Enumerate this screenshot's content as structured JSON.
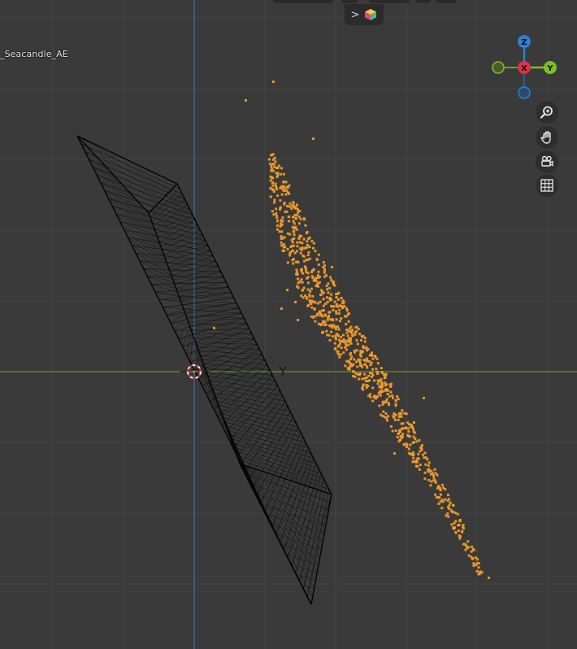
{
  "viewport": {
    "object_name": "_Seacandle_AE",
    "axis_label_y": "Y"
  },
  "gizmo": {
    "axes": [
      {
        "label": "Z",
        "color": "#2f7fd6"
      },
      {
        "label": "X",
        "color": "#e0304a"
      },
      {
        "label": "Y",
        "color": "#7cc026"
      }
    ],
    "negative_axis_colors": {
      "y": "#6f9a2d",
      "z": "#2d5a8f"
    }
  },
  "navigation": {
    "icons": [
      "zoom-icon",
      "pan-hand-icon",
      "camera-icon",
      "grid-icon"
    ]
  },
  "header": {
    "toggle_icon": "chevron-right-icon",
    "editor_icon": "color-cube-icon"
  },
  "colors": {
    "background": "#3a3a3a",
    "grid": "#444444",
    "x_axis": "#6d8f2b",
    "y_axis": "#3c6ea8",
    "selection_orange": "#ef9a2c",
    "wireframe": "#050505"
  }
}
